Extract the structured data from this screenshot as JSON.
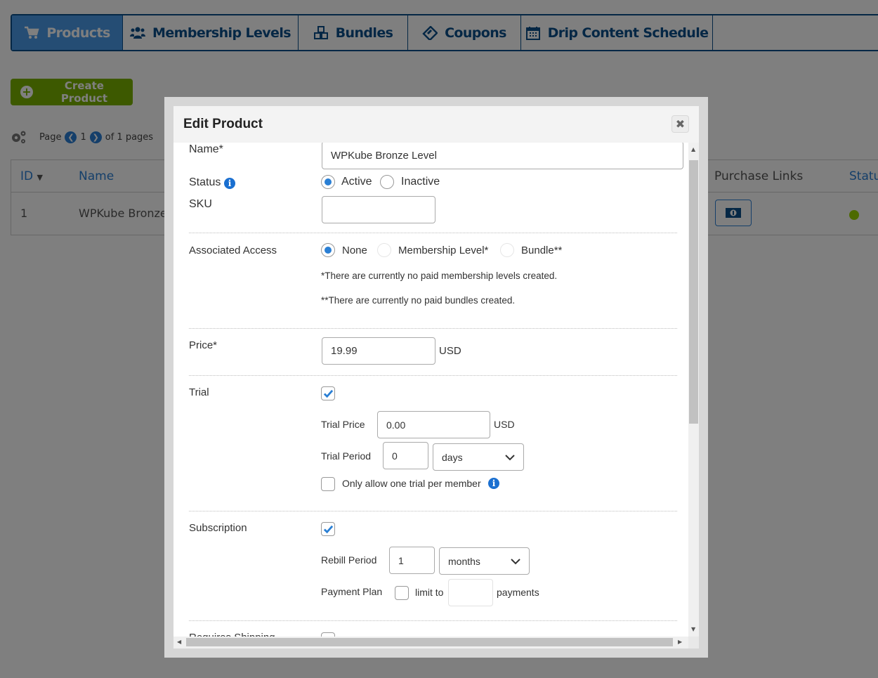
{
  "tabs": [
    {
      "label": "Products",
      "icon": "cart-icon",
      "active": true
    },
    {
      "label": "Membership Levels",
      "icon": "users-icon",
      "active": false
    },
    {
      "label": "Bundles",
      "icon": "cubes-icon",
      "active": false
    },
    {
      "label": "Coupons",
      "icon": "ticket-icon",
      "active": false
    },
    {
      "label": "Drip Content Schedule",
      "icon": "calendar-icon",
      "active": false
    }
  ],
  "toolbar": {
    "create_label": "Create Product"
  },
  "pager": {
    "page_label": "Page",
    "current": "1",
    "of_label": "of 1 pages"
  },
  "table": {
    "headers": {
      "id": "ID",
      "name": "Name",
      "purchase_links": "Purchase Links",
      "status": "Statu"
    },
    "rows": [
      {
        "id": "1",
        "name": "WPKube Bronze Le",
        "status_color": "#9ad400"
      }
    ]
  },
  "modal": {
    "title": "Edit Product",
    "close_icon": "close-icon",
    "name": {
      "label": "Name*",
      "value": "WPKube Bronze Level"
    },
    "status": {
      "label": "Status",
      "options": [
        "Active",
        "Inactive"
      ],
      "selected": "Active"
    },
    "sku": {
      "label": "SKU",
      "value": ""
    },
    "associated_access": {
      "label": "Associated Access",
      "options": [
        "None",
        "Membership Level*",
        "Bundle**"
      ],
      "selected": "None",
      "note_levels": "*There are currently no paid membership levels created.",
      "note_bundles": "**There are currently no paid bundles created."
    },
    "price": {
      "label": "Price*",
      "value": "19.99",
      "currency": "USD"
    },
    "trial": {
      "label": "Trial",
      "checked": true,
      "price_label": "Trial Price",
      "price_value": "0.00",
      "price_currency": "USD",
      "period_label": "Trial Period",
      "period_value": "0",
      "period_unit": "days",
      "one_trial_label": "Only allow one trial per member",
      "one_trial_checked": false
    },
    "subscription": {
      "label": "Subscription",
      "checked": true,
      "rebill_label": "Rebill Period",
      "rebill_value": "1",
      "rebill_unit": "months",
      "payment_plan_label": "Payment Plan",
      "payment_plan_checked": false,
      "limit_to_label": "limit to",
      "limit_value": "",
      "payments_label": "payments"
    },
    "requires_shipping": {
      "label": "Requires Shipping",
      "checked": false
    }
  },
  "colors": {
    "brand_blue": "#0b4f8a",
    "link_blue": "#2a7fd4",
    "create_green": "#7bb300",
    "active_tab": "#4a9be8"
  }
}
